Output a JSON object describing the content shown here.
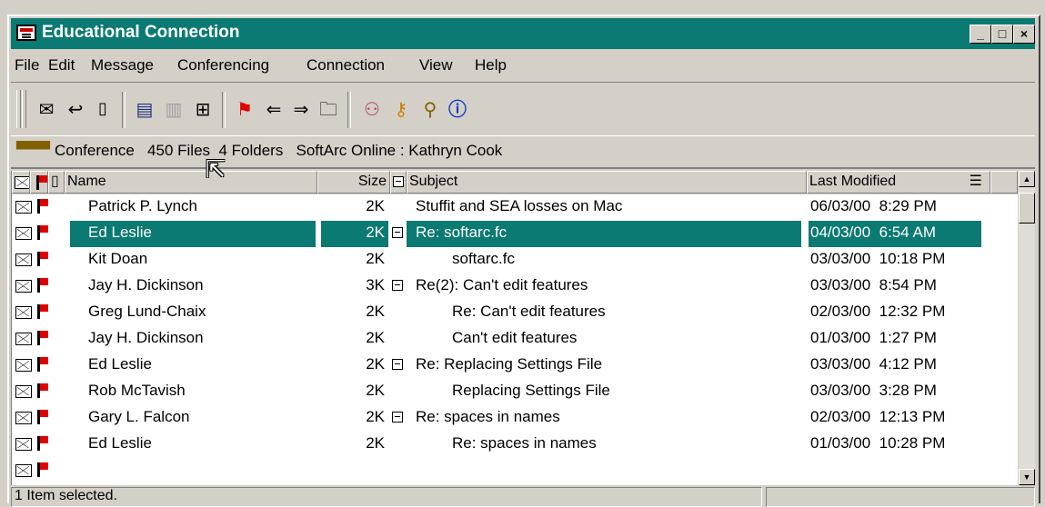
{
  "window": {
    "title": "Educational Connection",
    "controls": {
      "minimize": "_",
      "maximize": "□",
      "close": "×"
    }
  },
  "menu": [
    "File",
    "Edit",
    "Message",
    "Conferencing",
    "Connection",
    "View",
    "Help"
  ],
  "toolbar": {
    "icons": [
      "new-message-icon",
      "reply-icon",
      "new-document-icon",
      "save-icon",
      "delete-icon",
      "thread-icon",
      "next-flag-icon",
      "previous-icon",
      "next-icon",
      "open-folder-icon",
      "users-add-icon",
      "users-key-icon",
      "search-icon",
      "info-icon"
    ]
  },
  "status_line": {
    "icon": "conference-icon",
    "text": "Conference   450 Files  4 Folders   SoftArc Online : Kathryn Cook"
  },
  "list": {
    "columns": {
      "name": "Name",
      "size": "Size",
      "subject": "Subject",
      "modified": "Last Modified"
    },
    "rows": [
      {
        "name": "Patrick P. Lynch",
        "size": "2K",
        "subject": "Stuffit and SEA losses on Mac",
        "modified": "06/03/00  8:29 PM",
        "thread": false,
        "indent": false,
        "selected": false
      },
      {
        "name": "Ed Leslie",
        "size": "2K",
        "subject": "Re: softarc.fc",
        "modified": "04/03/00  6:54 AM",
        "thread": true,
        "indent": false,
        "selected": true
      },
      {
        "name": "Kit Doan",
        "size": "2K",
        "subject": "softarc.fc",
        "modified": "03/03/00  10:18 PM",
        "thread": false,
        "indent": true,
        "selected": false
      },
      {
        "name": "Jay H. Dickinson",
        "size": "3K",
        "subject": "Re(2): Can't edit features",
        "modified": "03/03/00  8:54 PM",
        "thread": true,
        "indent": false,
        "selected": false
      },
      {
        "name": "Greg Lund-Chaix",
        "size": "2K",
        "subject": "Re: Can't edit features",
        "modified": "02/03/00  12:32 PM",
        "thread": false,
        "indent": true,
        "selected": false
      },
      {
        "name": "Jay H. Dickinson",
        "size": "2K",
        "subject": "Can't edit features",
        "modified": "01/03/00  1:27 PM",
        "thread": false,
        "indent": true,
        "selected": false
      },
      {
        "name": "Ed Leslie",
        "size": "2K",
        "subject": "Re: Replacing Settings File",
        "modified": "03/03/00  4:12 PM",
        "thread": true,
        "indent": false,
        "selected": false
      },
      {
        "name": "Rob McTavish",
        "size": "2K",
        "subject": "Replacing Settings File",
        "modified": "03/03/00  3:28 PM",
        "thread": false,
        "indent": true,
        "selected": false
      },
      {
        "name": "Gary L. Falcon",
        "size": "2K",
        "subject": "Re: spaces in names",
        "modified": "02/03/00  12:13 PM",
        "thread": true,
        "indent": false,
        "selected": false
      },
      {
        "name": "Ed Leslie",
        "size": "2K",
        "subject": "Re: spaces in names",
        "modified": "01/03/00  10:28 PM",
        "thread": false,
        "indent": true,
        "selected": false
      }
    ]
  },
  "statusbar": {
    "text": "1 Item selected."
  },
  "colors": {
    "accent": "#0a7a72",
    "flag": "#e00000",
    "chrome": "#d4d0c8"
  }
}
